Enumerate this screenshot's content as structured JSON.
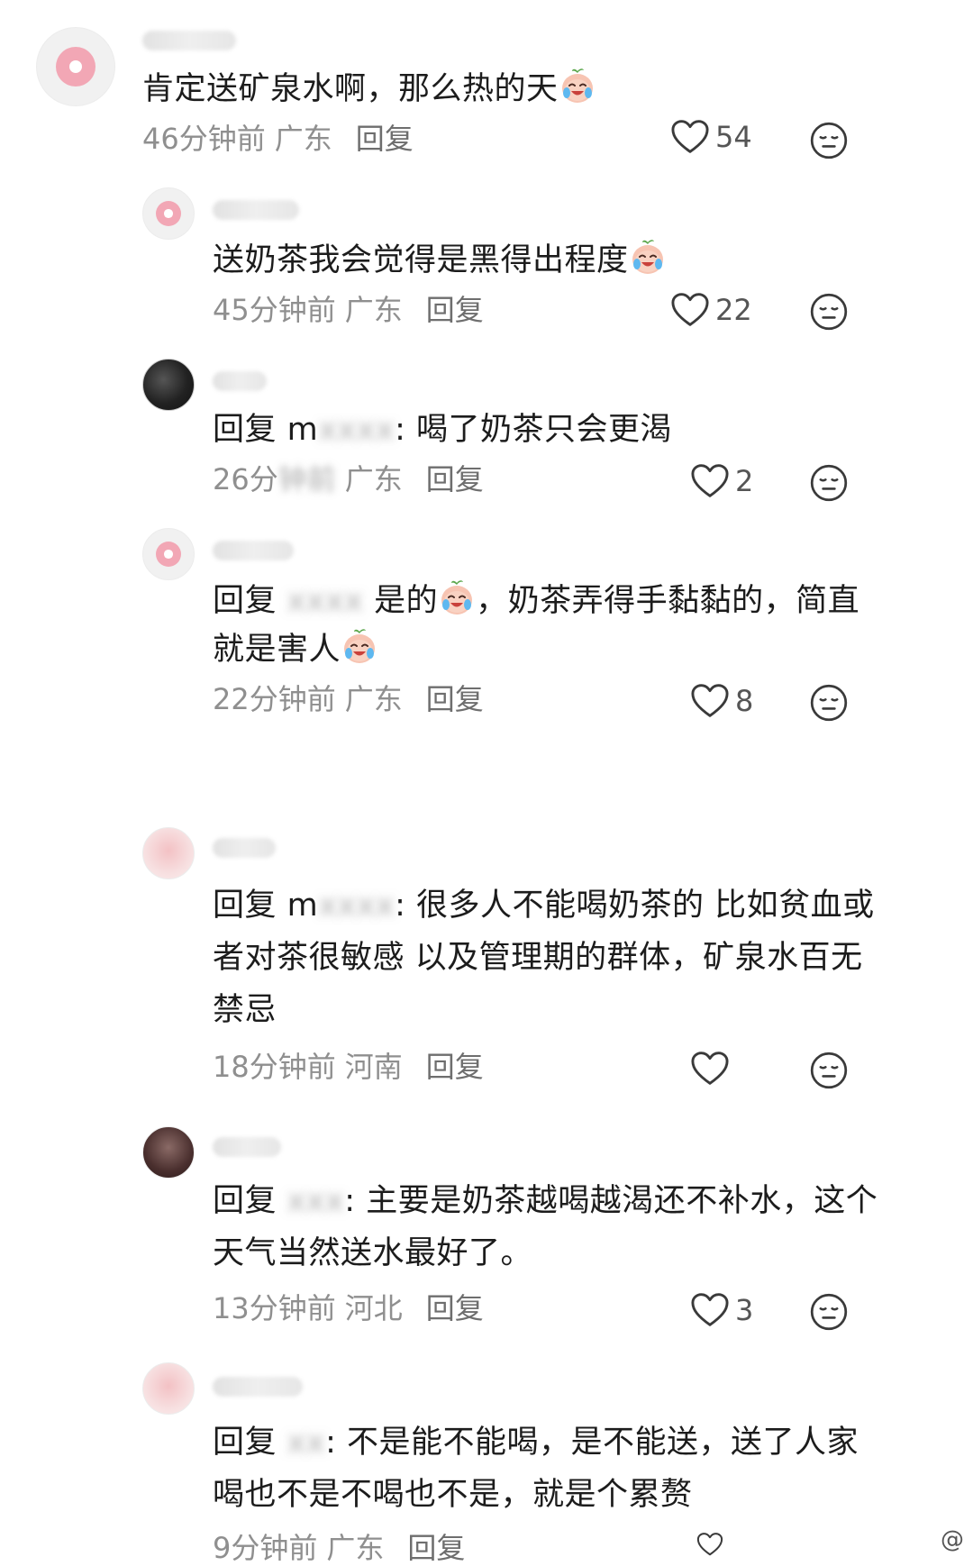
{
  "comments": [
    {
      "text": "肯定送矿泉水啊，那么热的天",
      "time": "46分钟前",
      "region": "广东",
      "reply": "回复",
      "likes": "54",
      "emoji_after": true
    },
    {
      "text": "送奶茶我会觉得是黑得出程度",
      "time": "45分钟前",
      "region": "广东",
      "reply": "回复",
      "likes": "22",
      "emoji_after": true
    },
    {
      "prefix": "回复",
      "mention": "m",
      "text": ": 喝了奶茶只会更渴",
      "time": "26分",
      "region": "广东",
      "reply": "回复",
      "likes": "2"
    },
    {
      "prefix": "回复",
      "text_a": "是的",
      "text_b": "，奶茶弄得手黏黏的，简直",
      "text_c": "就是害人",
      "time": "22分钟前",
      "region": "广东",
      "reply": "回复",
      "likes": "8"
    },
    {
      "prefix": "回复",
      "mention": "m",
      "line1": ": 很多人不能喝奶茶的 比如贫血或",
      "line2": "者对茶很敏感 以及管理期的群体，矿泉水百无",
      "line3": "禁忌",
      "time": "18分钟前",
      "region": "河南",
      "reply": "回复",
      "likes": ""
    },
    {
      "prefix": "回复",
      "line1": ": 主要是奶茶越喝越渴还不补水，这个",
      "line2": "天气当然送水最好了。",
      "time": "13分钟前",
      "region": "河北",
      "reply": "回复",
      "likes": "3"
    },
    {
      "prefix": "回复",
      "line1": ": 不是能不能喝，是不能送，送了人家",
      "line2": "喝也不是不喝也不是，就是个累赘",
      "time": "9分钟前",
      "region": "广东",
      "reply": "回复",
      "likes": ""
    }
  ],
  "icons": {
    "like": "heart-outline-icon",
    "dislike": "neutral-face-icon",
    "emoji": "crying-laughing-peach-emoji"
  },
  "colors": {
    "meta": "#8f8f8f",
    "text": "#1c1c1c",
    "avatar_pink": "#f2a7b5"
  },
  "watermark": "@"
}
